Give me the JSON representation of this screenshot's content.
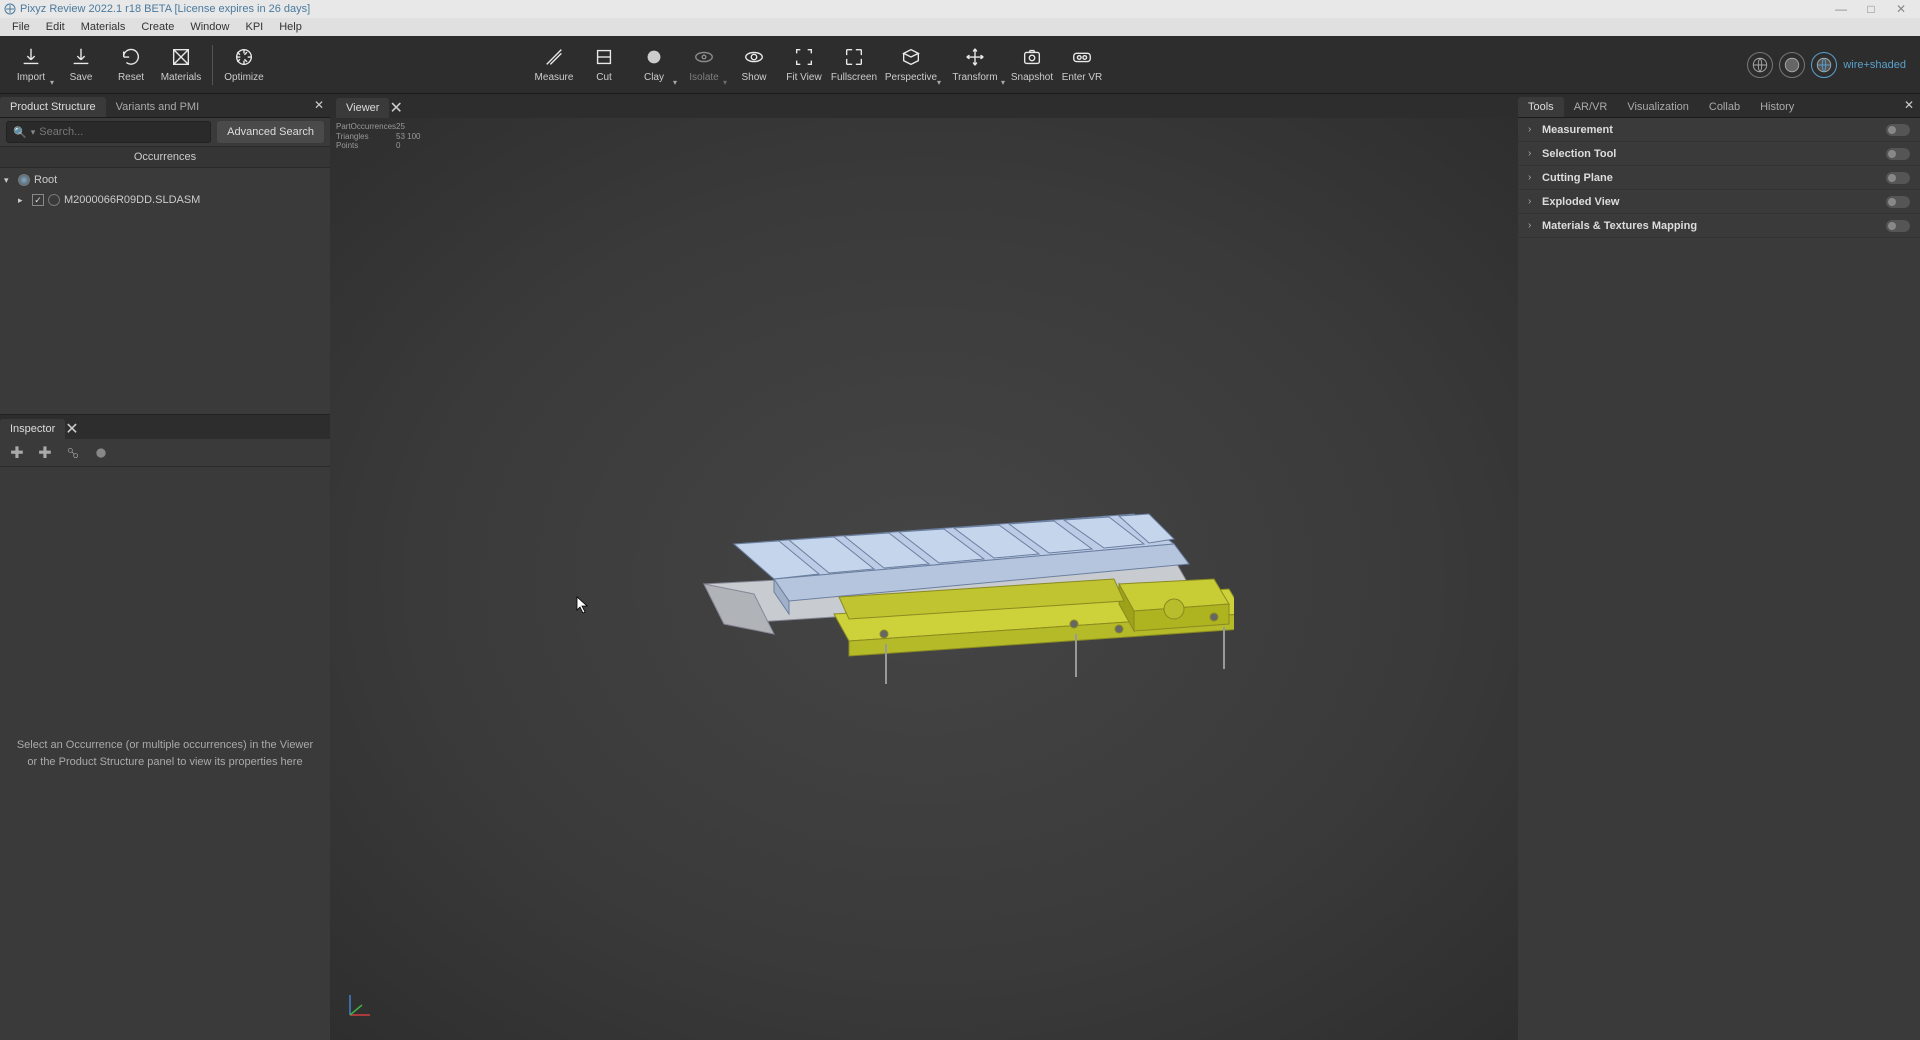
{
  "title": "Pixyz Review 2022.1 r18 BETA [License expires in 26 days]",
  "menu": [
    "File",
    "Edit",
    "Materials",
    "Create",
    "Window",
    "KPI",
    "Help"
  ],
  "toolbar": [
    {
      "id": "import",
      "label": "Import",
      "drop": true
    },
    {
      "id": "save",
      "label": "Save"
    },
    {
      "id": "reset",
      "label": "Reset"
    },
    {
      "id": "materials",
      "label": "Materials"
    },
    {
      "id": "optimize",
      "label": "Optimize"
    }
  ],
  "toolbar2": [
    {
      "id": "measure",
      "label": "Measure"
    },
    {
      "id": "cut",
      "label": "Cut"
    },
    {
      "id": "clay",
      "label": "Clay",
      "drop": true
    },
    {
      "id": "isolate",
      "label": "Isolate",
      "drop": true,
      "dim": true
    },
    {
      "id": "show",
      "label": "Show"
    },
    {
      "id": "fitview",
      "label": "Fit View"
    },
    {
      "id": "fullscreen",
      "label": "Fullscreen"
    },
    {
      "id": "perspective",
      "label": "Perspective",
      "drop": true
    },
    {
      "id": "transform",
      "label": "Transform",
      "drop": true
    },
    {
      "id": "snapshot",
      "label": "Snapshot"
    },
    {
      "id": "entervr",
      "label": "Enter VR"
    }
  ],
  "render_mode": "wire+shaded",
  "left_tabs": [
    "Product Structure",
    "Variants and PMI"
  ],
  "search_placeholder": "Search...",
  "adv_search": "Advanced Search",
  "occ_header": "Occurrences",
  "tree": {
    "root": "Root",
    "child": "M2000066R09DD.SLDASM"
  },
  "inspector_tab": "Inspector",
  "inspector_hint": "Select an Occurrence (or multiple occurrences) in the Viewer or the Product Structure panel to view its properties here",
  "viewer_tab": "Viewer",
  "stats": {
    "partocc_k": "PartOccurrences",
    "partocc_v": "25",
    "tri_k": "Triangles",
    "tri_v": "53 100",
    "pts_k": "Points",
    "pts_v": "0"
  },
  "right_tabs": [
    "Tools",
    "AR/VR",
    "Visualization",
    "Collab",
    "History"
  ],
  "tool_items": [
    "Measurement",
    "Selection Tool",
    "Cutting Plane",
    "Exploded View",
    "Materials & Textures Mapping"
  ]
}
